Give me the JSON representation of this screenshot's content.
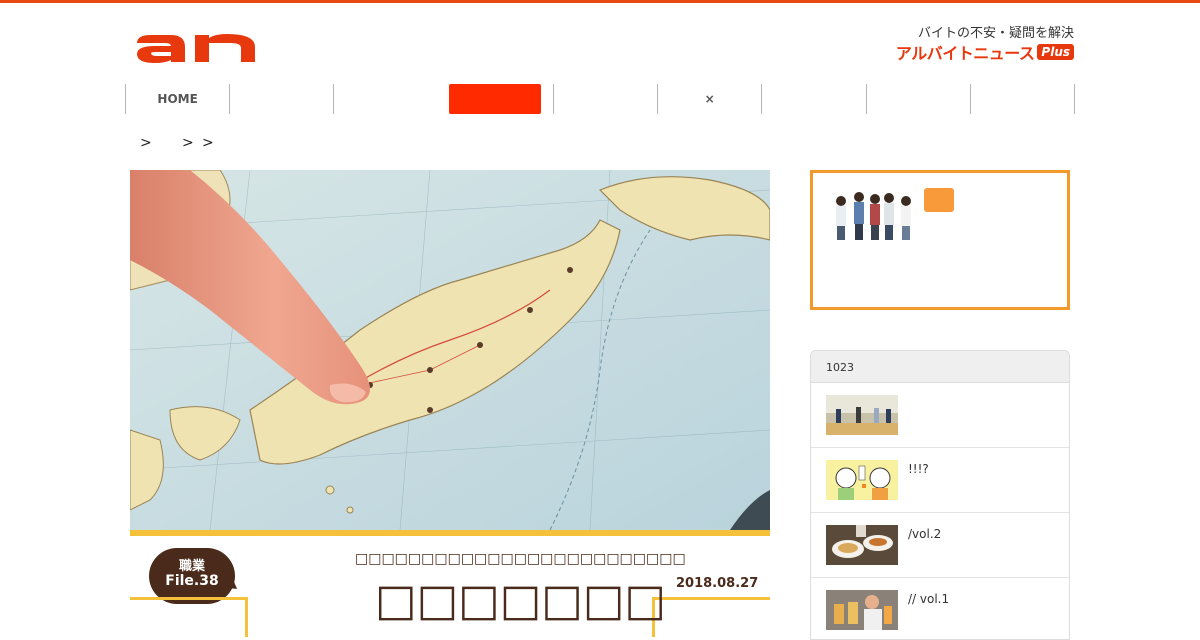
{
  "header": {
    "tagline": "バイトの不安・疑問を解決",
    "brand_name": "アルバイトニュース",
    "brand_plus": "Plus"
  },
  "nav": {
    "items": [
      "HOME",
      "",
      "",
      "",
      "",
      "×",
      "",
      "",
      ""
    ]
  },
  "breadcrumb": [
    ">",
    ">",
    ">"
  ],
  "article": {
    "badge_top": "職業",
    "badge_file": "File.38",
    "subtitle": "□□□□□□□□□□□□□□□□□□□□□□□□□",
    "title": "□□□□□□□",
    "date": "2018.08.27"
  },
  "ranking": {
    "header": "1023",
    "items": [
      {
        "text": ""
      },
      {
        "text": "!!!?"
      },
      {
        "text": "/vol.2"
      },
      {
        "text": "// vol.1"
      }
    ]
  },
  "colors": {
    "accent": "#e8380d",
    "nav_active": "#ff2a00",
    "frame_yellow": "#f5c13b",
    "promo_orange": "#f39a2c",
    "brown": "#4a2a1a"
  }
}
